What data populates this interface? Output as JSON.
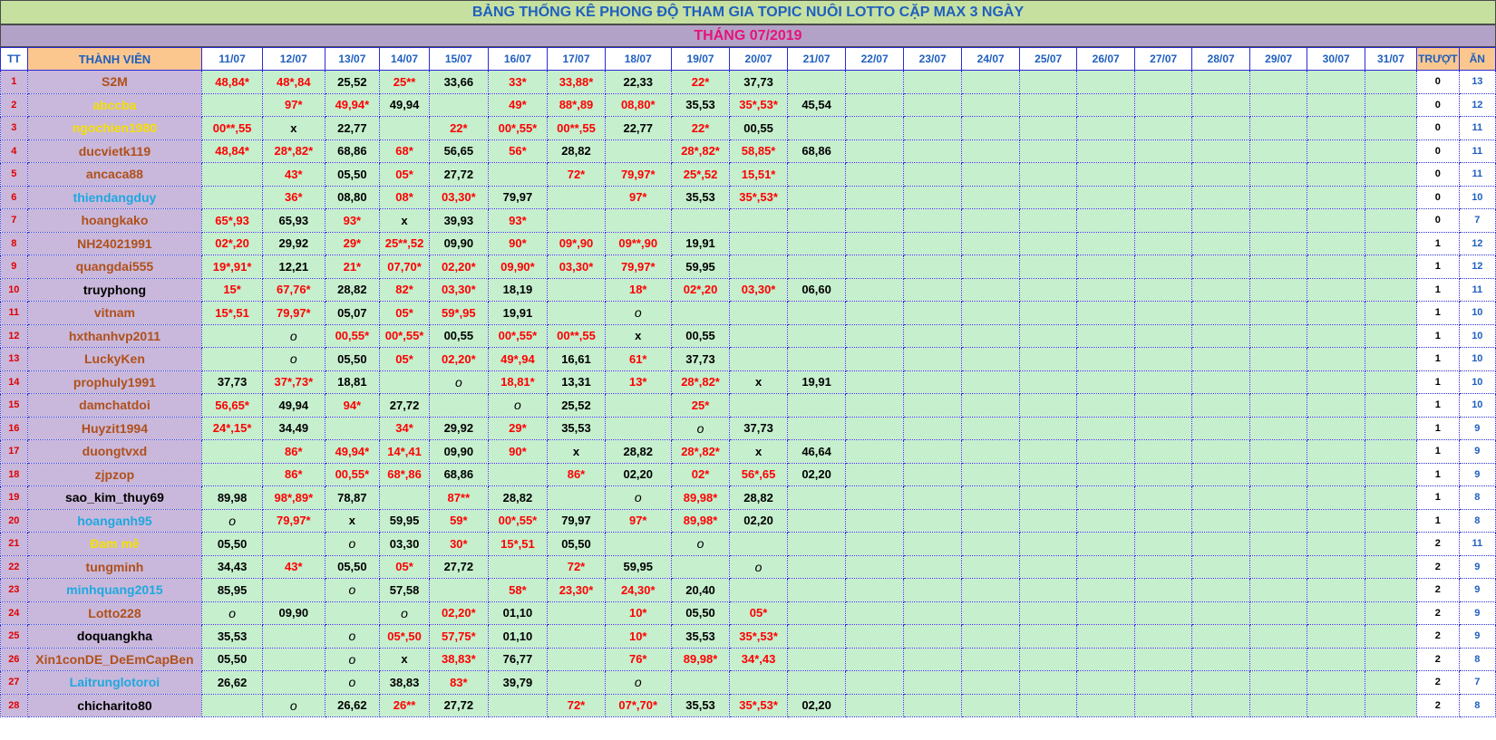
{
  "title": "BẢNG THỐNG KÊ PHONG ĐỘ  THAM GIA TOPIC NUÔI LOTTO CẶP MAX 3 NGÀY",
  "month": "THÁNG 07/2019",
  "headers": {
    "tt": "TT",
    "member": "THÀNH VIÊN",
    "dates": [
      "11/07",
      "12/07",
      "13/07",
      "14/07",
      "15/07",
      "16/07",
      "17/07",
      "18/07",
      "19/07",
      "20/07",
      "21/07",
      "22/07",
      "23/07",
      "24/07",
      "25/07",
      "26/07",
      "27/07",
      "28/07",
      "29/07",
      "30/07",
      "31/07"
    ],
    "miss": "TRƯỢT",
    "hit": "ĂN"
  },
  "colors": {
    "title_bg": "#c6e0a0",
    "title_text": "#1f5fbf",
    "month_bg": "#b3a2c7",
    "month_text": "#e8127c",
    "cell_bg": "#c6efce",
    "name_bg": "#c9b8db",
    "hit_red": "#ff0000",
    "name_brown": "#b0501a",
    "name_yellow": "#f5e000",
    "name_blue": "#1ea8e0",
    "name_black": "#000000"
  },
  "rows": [
    {
      "tt": "1",
      "name": "S2M",
      "color": "brown",
      "cells": [
        "48,84*",
        "48*,84",
        "25,52",
        "25**",
        "33,66",
        "33*",
        "33,88*",
        "22,33",
        "22*",
        "37,73",
        "",
        "",
        "",
        "",
        "",
        "",
        "",
        "",
        "",
        "",
        ""
      ],
      "miss": "0",
      "hit": "13"
    },
    {
      "tt": "2",
      "name": "abccba",
      "color": "yellow",
      "cells": [
        "",
        "97*",
        "49,94*",
        "49,94",
        "",
        "49*",
        "88*,89",
        "08,80*",
        "35,53",
        "35*,53*",
        "45,54",
        "",
        "",
        "",
        "",
        "",
        "",
        "",
        "",
        "",
        ""
      ],
      "miss": "0",
      "hit": "12"
    },
    {
      "tt": "3",
      "name": "ngochien1980",
      "color": "yellow",
      "cells": [
        "00**,55",
        "x",
        "22,77",
        "",
        "22*",
        "00*,55*",
        "00**,55",
        "22,77",
        "22*",
        "00,55",
        "",
        "",
        "",
        "",
        "",
        "",
        "",
        "",
        "",
        "",
        ""
      ],
      "miss": "0",
      "hit": "11"
    },
    {
      "tt": "4",
      "name": "ducvietk119",
      "color": "brown",
      "cells": [
        "48,84*",
        "28*,82*",
        "68,86",
        "68*",
        "56,65",
        "56*",
        "28,82",
        "",
        "28*,82*",
        "58,85*",
        "68,86",
        "",
        "",
        "",
        "",
        "",
        "",
        "",
        "",
        "",
        ""
      ],
      "miss": "0",
      "hit": "11"
    },
    {
      "tt": "5",
      "name": "ancaca88",
      "color": "brown",
      "cells": [
        "",
        "43*",
        "05,50",
        "05*",
        "27,72",
        "",
        "72*",
        "79,97*",
        "25*,52",
        "15,51*",
        "",
        "",
        "",
        "",
        "",
        "",
        "",
        "",
        "",
        "",
        ""
      ],
      "miss": "0",
      "hit": "11"
    },
    {
      "tt": "6",
      "name": "thiendangduy",
      "color": "blue",
      "cells": [
        "",
        "36*",
        "08,80",
        "08*",
        "03,30*",
        "79,97",
        "",
        "97*",
        "35,53",
        "35*,53*",
        "",
        "",
        "",
        "",
        "",
        "",
        "",
        "",
        "",
        "",
        ""
      ],
      "miss": "0",
      "hit": "10"
    },
    {
      "tt": "7",
      "name": "hoangkako",
      "color": "brown",
      "cells": [
        "65*,93",
        "65,93",
        "93*",
        "x",
        "39,93",
        "93*",
        "",
        "",
        "",
        "",
        "",
        "",
        "",
        "",
        "",
        "",
        "",
        "",
        "",
        "",
        ""
      ],
      "miss": "0",
      "hit": "7"
    },
    {
      "tt": "8",
      "name": "NH24021991",
      "color": "brown",
      "cells": [
        "02*,20",
        "29,92",
        "29*",
        "25**,52",
        "09,90",
        "90*",
        "09*,90",
        "09**,90",
        "19,91",
        "",
        "",
        "",
        "",
        "",
        "",
        "",
        "",
        "",
        "",
        "",
        ""
      ],
      "miss": "1",
      "hit": "12"
    },
    {
      "tt": "9",
      "name": "quangdai555",
      "color": "brown",
      "cells": [
        "19*,91*",
        "12,21",
        "21*",
        "07,70*",
        "02,20*",
        "09,90*",
        "03,30*",
        "79,97*",
        "59,95",
        "",
        "",
        "",
        "",
        "",
        "",
        "",
        "",
        "",
        "",
        "",
        ""
      ],
      "miss": "1",
      "hit": "12"
    },
    {
      "tt": "10",
      "name": "truyphong",
      "color": "black",
      "cells": [
        "15*",
        "67,76*",
        "28,82",
        "82*",
        "03,30*",
        "18,19",
        "",
        "18*",
        "02*,20",
        "03,30*",
        "06,60",
        "",
        "",
        "",
        "",
        "",
        "",
        "",
        "",
        "",
        ""
      ],
      "miss": "1",
      "hit": "11"
    },
    {
      "tt": "11",
      "name": "vitnam",
      "color": "brown",
      "cells": [
        "15*,51",
        "79,97*",
        "05,07",
        "05*",
        "59*,95",
        "19,91",
        "",
        "o",
        "",
        "",
        "",
        "",
        "",
        "",
        "",
        "",
        "",
        "",
        "",
        "",
        ""
      ],
      "miss": "1",
      "hit": "10"
    },
    {
      "tt": "12",
      "name": "hxthanhvp2011",
      "color": "brown",
      "cells": [
        "",
        "o",
        "00,55*",
        "00*,55*",
        "00,55",
        "00*,55*",
        "00**,55",
        "x",
        "00,55",
        "",
        "",
        "",
        "",
        "",
        "",
        "",
        "",
        "",
        "",
        "",
        ""
      ],
      "miss": "1",
      "hit": "10"
    },
    {
      "tt": "13",
      "name": "LuckyKen",
      "color": "brown",
      "cells": [
        "",
        "o",
        "05,50",
        "05*",
        "02,20*",
        "49*,94",
        "16,61",
        "61*",
        "37,73",
        "",
        "",
        "",
        "",
        "",
        "",
        "",
        "",
        "",
        "",
        "",
        ""
      ],
      "miss": "1",
      "hit": "10"
    },
    {
      "tt": "14",
      "name": "prophuly1991",
      "color": "brown",
      "cells": [
        "37,73",
        "37*,73*",
        "18,81",
        "",
        "o",
        "18,81*",
        "13,31",
        "13*",
        "28*,82*",
        "x",
        "19,91",
        "",
        "",
        "",
        "",
        "",
        "",
        "",
        "",
        "",
        ""
      ],
      "miss": "1",
      "hit": "10"
    },
    {
      "tt": "15",
      "name": "damchatdoi",
      "color": "brown",
      "cells": [
        "56,65*",
        "49,94",
        "94*",
        "27,72",
        "",
        "o",
        "25,52",
        "",
        "25*",
        "",
        "",
        "",
        "",
        "",
        "",
        "",
        "",
        "",
        "",
        "",
        ""
      ],
      "miss": "1",
      "hit": "10"
    },
    {
      "tt": "16",
      "name": "Huyzit1994",
      "color": "brown",
      "cells": [
        "24*,15*",
        "34,49",
        "",
        "34*",
        "29,92",
        "29*",
        "35,53",
        "",
        "o",
        "37,73",
        "",
        "",
        "",
        "",
        "",
        "",
        "",
        "",
        "",
        "",
        ""
      ],
      "miss": "1",
      "hit": "9"
    },
    {
      "tt": "17",
      "name": "duongtvxd",
      "color": "brown",
      "cells": [
        "",
        "86*",
        "49,94*",
        "14*,41",
        "09,90",
        "90*",
        "x",
        "28,82",
        "28*,82*",
        "x",
        "46,64",
        "",
        "",
        "",
        "",
        "",
        "",
        "",
        "",
        "",
        ""
      ],
      "miss": "1",
      "hit": "9"
    },
    {
      "tt": "18",
      "name": "zjpzop",
      "color": "brown",
      "cells": [
        "",
        "86*",
        "00,55*",
        "68*,86",
        "68,86",
        "",
        "86*",
        "02,20",
        "02*",
        "56*,65",
        "02,20",
        "",
        "",
        "",
        "",
        "",
        "",
        "",
        "",
        "",
        ""
      ],
      "miss": "1",
      "hit": "9"
    },
    {
      "tt": "19",
      "name": "sao_kim_thuy69",
      "color": "black",
      "cells": [
        "89,98",
        "98*,89*",
        "78,87",
        "",
        "87**",
        "28,82",
        "",
        "o",
        "89,98*",
        "28,82",
        "",
        "",
        "",
        "",
        "",
        "",
        "",
        "",
        "",
        "",
        ""
      ],
      "miss": "1",
      "hit": "8"
    },
    {
      "tt": "20",
      "name": "hoanganh95",
      "color": "blue",
      "cells": [
        "o",
        "79,97*",
        "x",
        "59,95",
        "59*",
        "00*,55*",
        "79,97",
        "97*",
        "89,98*",
        "02,20",
        "",
        "",
        "",
        "",
        "",
        "",
        "",
        "",
        "",
        "",
        ""
      ],
      "miss": "1",
      "hit": "8"
    },
    {
      "tt": "21",
      "name": "Đam mê",
      "color": "yellow",
      "cells": [
        "05,50",
        "",
        "o",
        "03,30",
        "30*",
        "15*,51",
        "05,50",
        "",
        "o",
        "",
        "",
        "",
        "",
        "",
        "",
        "",
        "",
        "",
        "",
        "",
        ""
      ],
      "miss": "2",
      "hit": "11"
    },
    {
      "tt": "22",
      "name": "tungminh",
      "color": "brown",
      "cells": [
        "34,43",
        "43*",
        "05,50",
        "05*",
        "27,72",
        "",
        "72*",
        "59,95",
        "",
        "o",
        "",
        "",
        "",
        "",
        "",
        "",
        "",
        "",
        "",
        "",
        ""
      ],
      "miss": "2",
      "hit": "9"
    },
    {
      "tt": "23",
      "name": "minhquang2015",
      "color": "blue",
      "cells": [
        "85,95",
        "",
        "o",
        "57,58",
        "",
        "58*",
        "23,30*",
        "24,30*",
        "20,40",
        "",
        "",
        "",
        "",
        "",
        "",
        "",
        "",
        "",
        "",
        "",
        ""
      ],
      "miss": "2",
      "hit": "9"
    },
    {
      "tt": "24",
      "name": "Lotto228",
      "color": "brown",
      "cells": [
        "o",
        "09,90",
        "",
        "o",
        "02,20*",
        "01,10",
        "",
        "10*",
        "05,50",
        "05*",
        "",
        "",
        "",
        "",
        "",
        "",
        "",
        "",
        "",
        "",
        ""
      ],
      "miss": "2",
      "hit": "9"
    },
    {
      "tt": "25",
      "name": "doquangkha",
      "color": "black",
      "cells": [
        "35,53",
        "",
        "o",
        "05*,50",
        "57,75*",
        "01,10",
        "",
        "10*",
        "35,53",
        "35*,53*",
        "",
        "",
        "",
        "",
        "",
        "",
        "",
        "",
        "",
        "",
        ""
      ],
      "miss": "2",
      "hit": "9"
    },
    {
      "tt": "26",
      "name": "Xin1conDE_DeEmCapBen",
      "color": "brown",
      "cells": [
        "05,50",
        "",
        "o",
        "x",
        "38,83*",
        "76,77",
        "",
        "76*",
        "89,98*",
        "34*,43",
        "",
        "",
        "",
        "",
        "",
        "",
        "",
        "",
        "",
        "",
        ""
      ],
      "miss": "2",
      "hit": "8"
    },
    {
      "tt": "27",
      "name": "Laitrunglotoroi",
      "color": "blue",
      "cells": [
        "26,62",
        "",
        "o",
        "38,83",
        "83*",
        "39,79",
        "",
        "o",
        "",
        "",
        "",
        "",
        "",
        "",
        "",
        "",
        "",
        "",
        "",
        "",
        ""
      ],
      "miss": "2",
      "hit": "7"
    },
    {
      "tt": "28",
      "name": "chicharito80",
      "color": "black",
      "cells": [
        "",
        "o",
        "26,62",
        "26**",
        "27,72",
        "",
        "72*",
        "07*,70*",
        "35,53",
        "35*,53*",
        "02,20",
        "",
        "",
        "",
        "",
        "",
        "",
        "",
        "",
        "",
        ""
      ],
      "miss": "2",
      "hit": "8"
    }
  ]
}
